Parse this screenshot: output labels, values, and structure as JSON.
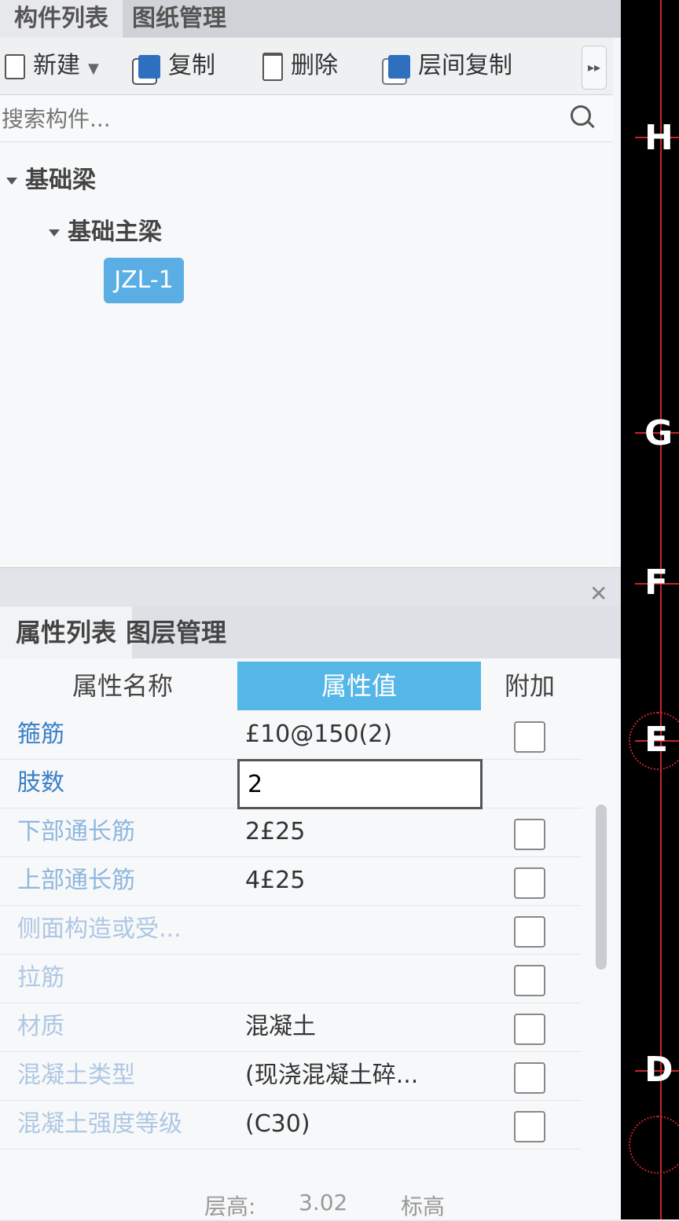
{
  "top_tabs": [
    "构件列表",
    "图纸管理"
  ],
  "toolbar": {
    "new_label": "新建",
    "copy_label": "复制",
    "delete_label": "删除",
    "floor_copy_label": "层间复制",
    "more_label": "▸▸"
  },
  "search": {
    "placeholder": "搜索构件..."
  },
  "tree": {
    "root": "基础梁",
    "child": "基础主梁",
    "leaf": "JZL-1"
  },
  "bottom_tabs": [
    "属性列表",
    "图层管理"
  ],
  "grid": {
    "headers": {
      "name": "属性名称",
      "value": "属性值",
      "add": "附加"
    },
    "rows": [
      {
        "name": "箍筋",
        "value": "£10@150(2)",
        "checkbox": true
      },
      {
        "name": "肢数",
        "value": "2",
        "checkbox": false
      },
      {
        "name": "下部通长筋",
        "value": "2£25",
        "checkbox": true
      },
      {
        "name": "上部通长筋",
        "value": "4£25",
        "checkbox": true
      },
      {
        "name": "侧面构造或受...",
        "value": "",
        "checkbox": true
      },
      {
        "name": "拉筋",
        "value": "",
        "checkbox": true
      },
      {
        "name": "材质",
        "value": "混凝土",
        "checkbox": true
      },
      {
        "name": "混凝土类型",
        "value": "(现浇混凝土碎...",
        "checkbox": true
      },
      {
        "name": "混凝土强度等级",
        "value": "(C30)",
        "checkbox": true
      }
    ]
  },
  "footer": {
    "floor_height_label": "层高:",
    "floor_height_value": "3.02",
    "elev_label": "标高"
  },
  "canvas": {
    "axes": [
      "H",
      "G",
      "F",
      "E",
      "D"
    ]
  },
  "colors": {
    "accent": "#55b6e8",
    "selected_leaf": "#5aaee3",
    "axis_line": "#c4262b"
  }
}
